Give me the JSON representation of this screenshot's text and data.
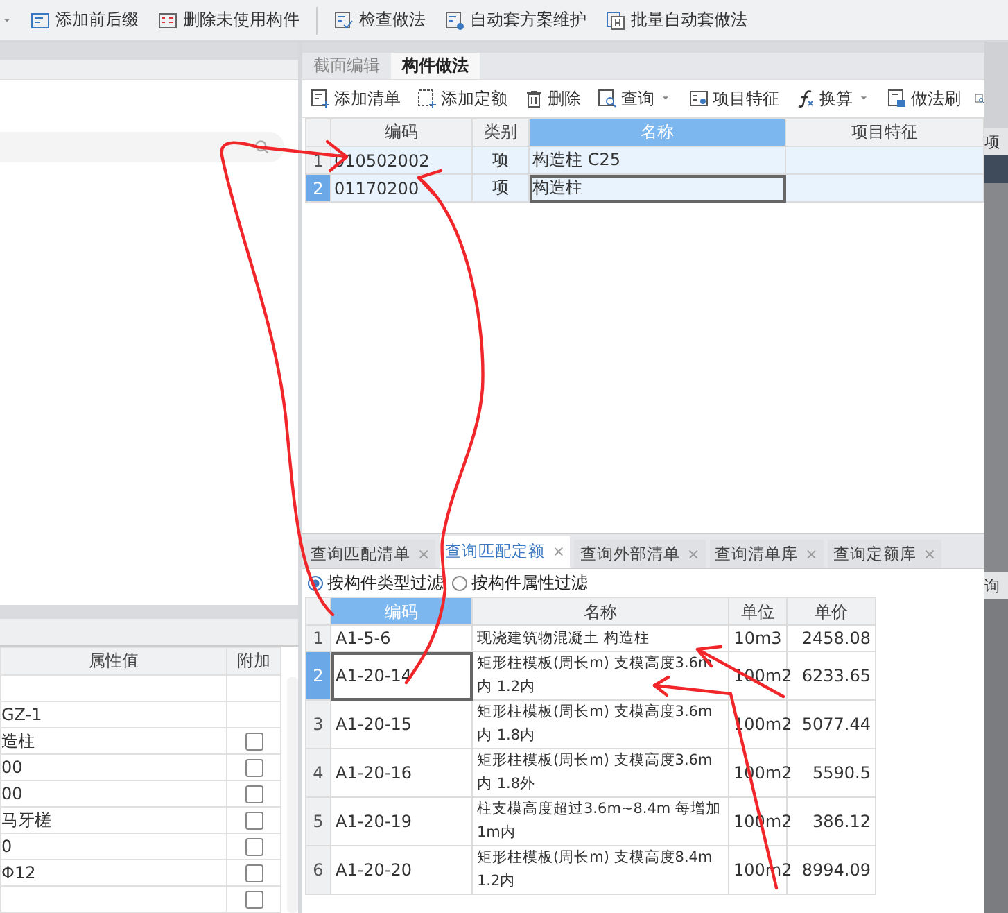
{
  "toolbar": {
    "items": [
      {
        "label": "添加前后缀"
      },
      {
        "label": "删除未使用构件"
      },
      {
        "label": "检查做法"
      },
      {
        "label": "自动套方案维护"
      },
      {
        "label": "批量自动套做法"
      }
    ]
  },
  "property_table": {
    "columns": [
      "属性值",
      "附加"
    ],
    "rows": [
      {
        "kind": "text",
        "value": ""
      },
      {
        "kind": "text",
        "value": "GZ-1"
      },
      {
        "kind": "checkbox",
        "value": "造柱",
        "checked": false
      },
      {
        "kind": "checkbox",
        "value": "00",
        "checked": false
      },
      {
        "kind": "checkbox",
        "value": "00",
        "checked": false
      },
      {
        "kind": "checkbox",
        "value": "马牙槎",
        "checked": false
      },
      {
        "kind": "checkbox",
        "value": "0",
        "checked": false
      },
      {
        "kind": "checkbox",
        "value": "Φ12",
        "checked": false
      },
      {
        "kind": "checkbox",
        "value": "",
        "checked": false
      }
    ]
  },
  "method_panel": {
    "tabs": [
      {
        "label": "截面编辑",
        "selected": false
      },
      {
        "label": "构件做法",
        "selected": true
      }
    ],
    "toolbar": [
      {
        "label": "添加清单",
        "dropdown": false
      },
      {
        "label": "添加定额",
        "dropdown": false
      },
      {
        "label": "删除",
        "dropdown": false
      },
      {
        "label": "查询",
        "dropdown": true
      },
      {
        "label": "项目特征",
        "dropdown": false
      },
      {
        "label": "换算",
        "dropdown": true
      },
      {
        "label": "做法刷",
        "dropdown": false
      }
    ],
    "columns": [
      {
        "label": "编码",
        "highlighted": false
      },
      {
        "label": "类别",
        "highlighted": false
      },
      {
        "label": "名称",
        "highlighted": true
      },
      {
        "label": "项目特征",
        "highlighted": false
      }
    ],
    "rows": [
      {
        "number": "1",
        "code": "010502002",
        "type": "项",
        "name": "构造柱 C25",
        "selected": false
      },
      {
        "number": "2",
        "code": "01170200",
        "type": "项",
        "name": "构造柱",
        "selected": true
      }
    ]
  },
  "query_panel": {
    "tabs": [
      {
        "label": "查询匹配清单",
        "close": "×",
        "selected": false
      },
      {
        "label": "查询匹配定额",
        "close": "×",
        "selected": true
      },
      {
        "label": "查询外部清单",
        "close": "×",
        "selected": false
      },
      {
        "label": "查询清单库",
        "close": "×",
        "selected": false
      },
      {
        "label": "查询定额库",
        "close": "×",
        "selected": false
      }
    ],
    "filters": [
      {
        "label": "按构件类型过滤",
        "selected": true
      },
      {
        "label": "按构件属性过滤",
        "selected": false
      }
    ],
    "columns": [
      {
        "label": "编码",
        "highlighted": true
      },
      {
        "label": "名称",
        "highlighted": false
      },
      {
        "label": "单位",
        "highlighted": false
      },
      {
        "label": "单价",
        "highlighted": false
      }
    ],
    "rows": [
      {
        "number": "1",
        "code": "A1-5-6",
        "name": "现浇建筑物混凝土 构造柱",
        "unit": "10m3",
        "price": "2458.08",
        "selected": false
      },
      {
        "number": "2",
        "code": "A1-20-14",
        "name": "矩形柱模板(周长m) 支模高度3.6m内 1.2内",
        "unit": "100m2",
        "price": "6233.65",
        "selected": true
      },
      {
        "number": "3",
        "code": "A1-20-15",
        "name": "矩形柱模板(周长m) 支模高度3.6m内 1.8内",
        "unit": "100m2",
        "price": "5077.44",
        "selected": false
      },
      {
        "number": "4",
        "code": "A1-20-16",
        "name": "矩形柱模板(周长m) 支模高度3.6m内 1.8外",
        "unit": "100m2",
        "price": "5590.5",
        "selected": false
      },
      {
        "number": "5",
        "code": "A1-20-19",
        "name": "柱支模高度超过3.6m~8.4m 每增加1m内",
        "unit": "100m2",
        "price": "386.12",
        "selected": false
      },
      {
        "number": "6",
        "code": "A1-20-20",
        "name": "矩形柱模板(周长m) 支模高度8.4m 1.2内",
        "unit": "100m2",
        "price": "8994.09",
        "selected": false
      }
    ]
  },
  "side_strip": {
    "texts": [
      "项",
      "询"
    ]
  }
}
